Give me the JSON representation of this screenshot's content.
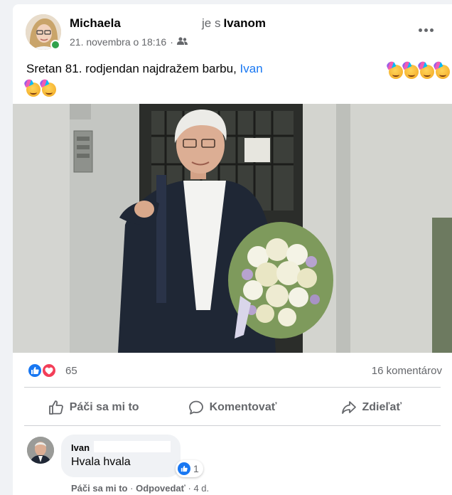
{
  "post": {
    "author": "Michaela",
    "with_prefix": "je s",
    "with_name": "Ivanom",
    "date": "21. novembra o 18:16",
    "separator": "·",
    "audience_icon": "friends-icon",
    "more_icon": "more-options-icon",
    "text": "Sretan 81. rodjendan najdražem barbu,",
    "mention": "Ivan",
    "emoji": "party-face-emoji",
    "emoji_count": 6
  },
  "stats": {
    "reactions": [
      "like-reaction-icon",
      "love-reaction-icon"
    ],
    "reaction_count": "65",
    "comment_count": "16 komentárov"
  },
  "actions": {
    "like": "Páči sa mi to",
    "comment": "Komentovať",
    "share": "Zdieľať"
  },
  "comment": {
    "name": "Ivan",
    "text": "Hvala hvala",
    "reaction_count": "1",
    "like": "Páči sa mi to",
    "separator": "·",
    "reply": "Odpovedať",
    "time": "4 d."
  },
  "colors": {
    "accent": "#1877f2",
    "love": "#f33e58",
    "online": "#31a24c",
    "secondary_text": "#65676b"
  }
}
